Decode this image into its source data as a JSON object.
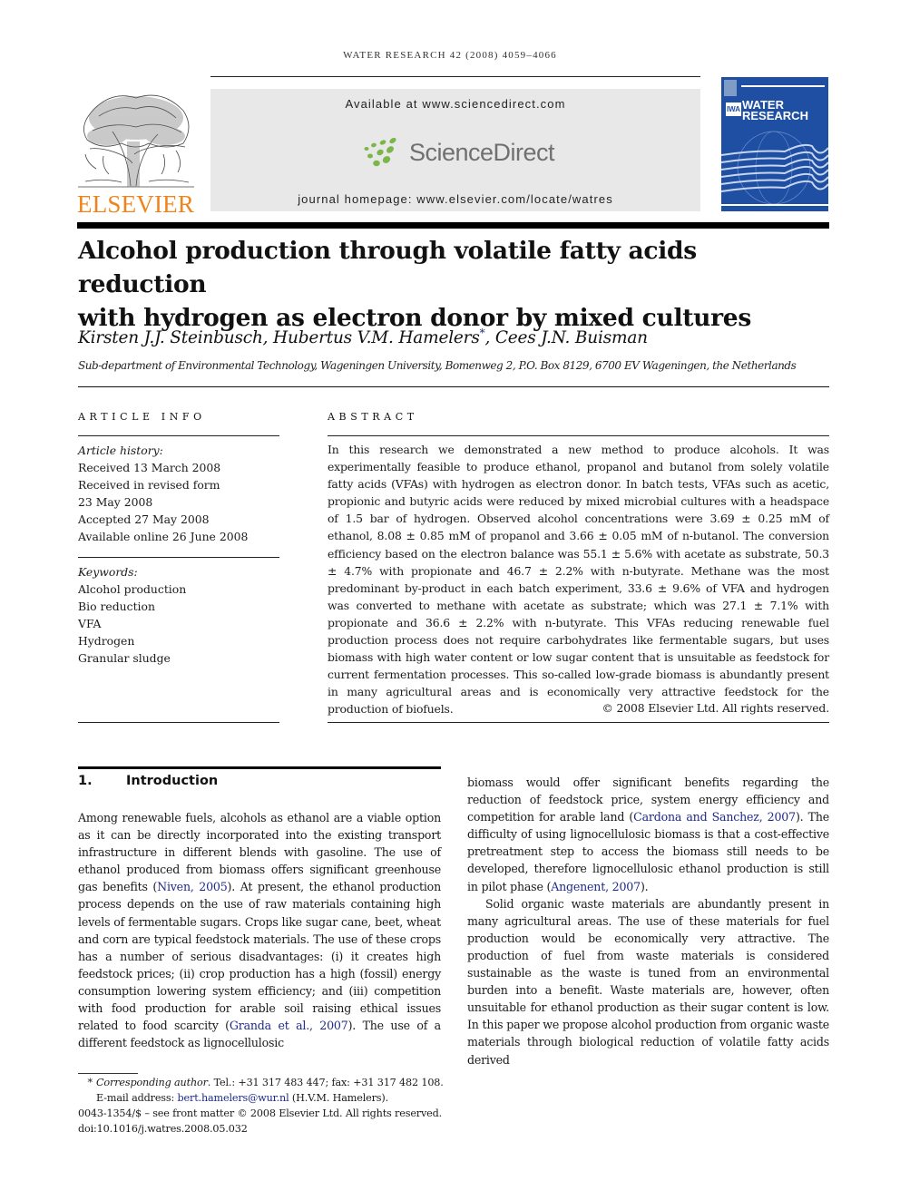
{
  "running_head": "WATER RESEARCH 42 (2008) 4059–4066",
  "publisher": {
    "logo_word": "ELSEVIER",
    "logo_color": "#f0841c"
  },
  "banner": {
    "available_text": "Available at www.sciencedirect.com",
    "brand": "ScienceDirect",
    "brand_dot_color": "#7ab648",
    "homepage_text": "journal homepage: www.elsevier.com/locate/watres"
  },
  "journal_cover": {
    "badge": "IWA",
    "title_line1": "WATER",
    "title_line2": "RESEARCH",
    "color": "#1f4fa2"
  },
  "article": {
    "title_line1": "Alcohol production through volatile fatty acids reduction",
    "title_line2": "with hydrogen as electron donor by mixed cultures",
    "authors": [
      {
        "name": "Kirsten J.J. Steinbusch",
        "separator": ", "
      },
      {
        "name": "Hubertus V.M. Hamelers",
        "mark": "*",
        "separator": ", "
      },
      {
        "name": "Cees J.N. Buisman",
        "separator": ""
      }
    ],
    "affiliation": "Sub-department of Environmental Technology, Wageningen University, Bomenweg 2, P.O. Box 8129, 6700 EV Wageningen, the Netherlands"
  },
  "article_info": {
    "heading": "ARTICLE INFO",
    "history_label": "Article history:",
    "history": [
      "Received 13 March 2008",
      "Received in revised form",
      "23 May 2008",
      "Accepted 27 May 2008",
      "Available online 26 June 2008"
    ],
    "keywords_label": "Keywords:",
    "keywords": [
      "Alcohol production",
      "Bio reduction",
      "VFA",
      "Hydrogen",
      "Granular sludge"
    ]
  },
  "abstract": {
    "heading": "ABSTRACT",
    "text": "In this research we demonstrated a new method to produce alcohols. It was experimentally feasible to produce ethanol, propanol and butanol from solely volatile fatty acids (VFAs) with hydrogen as electron donor. In batch tests, VFAs such as acetic, propionic and butyric acids were reduced by mixed microbial cultures with a headspace of 1.5 bar of hydrogen. Observed alcohol concentrations were 3.69 ± 0.25 mM of ethanol, 8.08 ± 0.85 mM of propanol and 3.66 ± 0.05 mM of n-butanol. The conversion efficiency based on the electron balance was 55.1 ± 5.6% with acetate as substrate, 50.3 ± 4.7% with propionate and 46.7 ± 2.2% with n-butyrate. Methane was the most predominant by-product in each batch experiment, 33.6 ± 9.6% of VFA and hydrogen was converted to methane with acetate as substrate; which was 27.1 ± 7.1% with propionate and 36.6 ± 2.2% with n-butyrate. This VFAs reducing renewable fuel production process does not require carbohydrates like fermentable sugars, but uses biomass with high water content or low sugar content that is unsuitable as feedstock for current fermentation processes. This so-called low-grade biomass is abundantly present in many agricultural areas and is economically very attractive feedstock for the production of biofuels.",
    "copyright": "© 2008 Elsevier Ltd. All rights reserved."
  },
  "introduction": {
    "number": "1.",
    "heading": "Introduction",
    "left_p1_a": "Among renewable fuels, alcohols as ethanol are a viable option as it can be directly incorporated into the existing transport infrastructure in different blends with gasoline. The use of ethanol produced from biomass offers significant greenhouse gas benefits (",
    "left_ref1": "Niven, 2005",
    "left_p1_b": "). At present, the ethanol production process depends on the use of raw materials containing high levels of fermentable sugars. Crops like sugar cane, beet, wheat and corn are typical feedstock materials. The use of these crops has a number of serious disadvantages: (i) it creates high feedstock prices; (ii) crop production has a high (fossil) energy consumption lowering system efficiency; and (iii) competition with food production for arable soil raising ethical issues related to food scarcity (",
    "left_ref2": "Granda et al., 2007",
    "left_p1_c": "). The use of a different feedstock as lignocellulosic",
    "right_p1_a": "biomass would offer significant benefits regarding the reduction of feedstock price, system energy efficiency and competition for arable land (",
    "right_ref1": "Cardona and Sanchez, 2007",
    "right_p1_b": "). The difficulty of using lignocellulosic biomass is that a cost-effective pretreatment step to access the biomass still needs to be developed, therefore lignocellulosic ethanol production is still in pilot phase (",
    "right_ref2": "Angenent, 2007",
    "right_p1_c": ").",
    "right_p2": "Solid organic waste materials are abundantly present in many agricultural areas. The use of these materials for fuel production would be economically very attractive. The production of fuel from waste materials is considered sustainable as the waste is tuned from an environmental burden into a benefit. Waste materials are, however, often unsuitable for ethanol production as their sugar content is low. In this paper we propose alcohol production from organic waste materials through biological reduction of volatile fatty acids derived"
  },
  "footnotes": {
    "star": "*",
    "corresponding_label": "Corresponding author",
    "contact": ". Tel.: +31 317 483 447; fax: +31 317 482 108.",
    "email_label": "E-mail address: ",
    "email": "bert.hamelers@wur.nl",
    "email_suffix": " (H.V.M. Hamelers).",
    "front_matter": "0043-1354/$ – see front matter © 2008 Elsevier Ltd. All rights reserved.",
    "doi": "doi:10.1016/j.watres.2008.05.032"
  },
  "link_color": "#1f2a8a"
}
